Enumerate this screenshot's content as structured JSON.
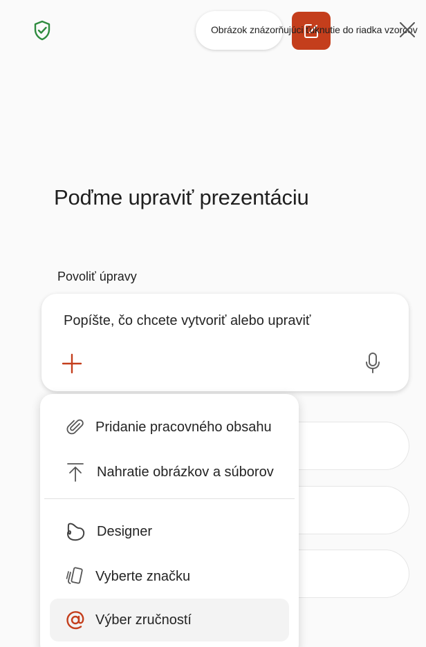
{
  "header": {
    "tooltip_text": "Obrázok znázorňujúci ťuknutie do riadka vzorcov"
  },
  "main": {
    "title": "Poďme upraviť prezentáciu",
    "edit_label": "Povoliť úpravy",
    "prompt_placeholder": "Popíšte, čo chcete vytvoriť alebo upraviť"
  },
  "menu": {
    "items": [
      {
        "label": "Pridanie pracovného obsahu",
        "icon": "paperclip-icon"
      },
      {
        "label": "Nahratie obrázkov a súborov",
        "icon": "upload-icon"
      },
      {
        "label": "Designer",
        "icon": "designer-icon"
      },
      {
        "label": "Vyberte značku",
        "icon": "brand-icon"
      },
      {
        "label": "Výber zručností",
        "icon": "at-sign-icon"
      }
    ]
  },
  "colors": {
    "accent": "#c43e1c",
    "shield": "#2e8b3e"
  }
}
